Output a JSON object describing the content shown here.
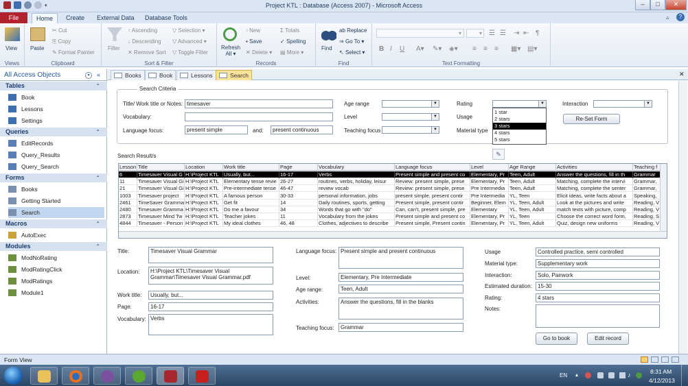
{
  "window": {
    "title": "Project KTL : Database (Access 2007)  -  Microsoft Access"
  },
  "ribbon_tabs": [
    "File",
    "Home",
    "Create",
    "External Data",
    "Database Tools"
  ],
  "ribbon": {
    "views": {
      "label": "Views",
      "view": "View"
    },
    "clipboard": {
      "label": "Clipboard",
      "paste": "Paste",
      "cut": "Cut",
      "copy": "Copy",
      "format_painter": "Format Painter"
    },
    "sortfilter": {
      "label": "Sort & Filter",
      "filter": "Filter",
      "ascending": "Ascending",
      "descending": "Descending",
      "remove_sort": "Remove Sort",
      "selection": "Selection",
      "advanced": "Advanced",
      "toggle_filter": "Toggle Filter"
    },
    "records": {
      "label": "Records",
      "refresh": "Refresh",
      "all": "All",
      "new": "New",
      "save": "Save",
      "delete": "Delete",
      "totals": "Totals",
      "spelling": "Spelling",
      "more": "More"
    },
    "find": {
      "label": "Find",
      "find": "Find",
      "replace": "Replace",
      "goto": "Go To",
      "select": "Select"
    },
    "textformatting": {
      "label": "Text Formatting"
    }
  },
  "nav": {
    "header": "All Access Objects",
    "sections": [
      {
        "title": "Tables",
        "items": [
          "Book",
          "Lessons",
          "Settings"
        ]
      },
      {
        "title": "Queries",
        "items": [
          "EditRecords",
          "Query_Results",
          "Query_Search"
        ]
      },
      {
        "title": "Forms",
        "items": [
          "Books",
          "Getting Started",
          "Search"
        ]
      },
      {
        "title": "Macros",
        "items": [
          "AutoExec"
        ]
      },
      {
        "title": "Modules",
        "items": [
          "ModNoRating",
          "ModRatingClick",
          "ModRatings",
          "Module1"
        ]
      }
    ]
  },
  "doc_tabs": [
    "Books",
    "Book",
    "Lessons",
    "Search"
  ],
  "criteria": {
    "title": "Search Criteria",
    "title_notes_label": "Title/ Work title or Notes:",
    "title_notes_value": "timesaver",
    "vocabulary_label": "Vocabulary:",
    "vocabulary_value": "",
    "language_focus_label": "Language focus:",
    "language_focus_value": "present simple",
    "and_label": "and:",
    "and_value": "present continuous",
    "age_range_label": "Age range",
    "level_label": "Level",
    "teaching_focus_label": "Teaching focus",
    "rating_label": "Rating",
    "usage_label": "Usage",
    "material_type_label": "Material type",
    "interaction_label": "Interaction",
    "reset_button": "Re-Set Form",
    "rating_options": [
      "1 star",
      "2 stars",
      "3 stars",
      "4 stars",
      "5 stars"
    ],
    "rating_selected": "3 stars"
  },
  "results": {
    "label": "Search Result/s",
    "columns": [
      "Lesson",
      "Title",
      "Location",
      "Work title",
      "Page",
      "Vocabulary",
      "Language focus",
      "Level",
      "Age Range",
      "Activities",
      "Teaching f"
    ],
    "rows": [
      [
        "6",
        "Timesaver Visual G",
        "H:\\Project KTL",
        "Usually, but...",
        "16-17",
        "Verbs",
        "Present simple and present co",
        "Elementary, Pr",
        "Teen, Adult",
        "Answer the questions, fill in th",
        "Grammar"
      ],
      [
        "11",
        "Timesaver Visual Gi",
        "H:\\Project KTL",
        "Elementary tense revie",
        "26-27",
        "routines, verbs, holiday, leisur",
        "Review: present simple, prese",
        "Elementary, Pr",
        "Teen, Adult",
        "Matching, complete the intervi",
        "Grammar,"
      ],
      [
        "21",
        "Timesaver Visual Gi",
        "H:\\Project KTL",
        "Pre-intermediate tense",
        "46-47",
        "review vocab",
        "Review: present simple, prese",
        "Pre Intermedia",
        "Teen, Adult",
        "Matching, complete the senter",
        "Grammar,"
      ],
      [
        "1003",
        "Timesaver project",
        "H:\\Project KTL",
        "A famous person",
        "30-33",
        "personal information, jobs",
        "present simple, present contir",
        "Pre Intermedia",
        "YL, Teen",
        "Elicit ideas, write facts about a",
        "Speaking,"
      ],
      [
        "2461",
        "TimeSaver Gramma",
        "H:\\Project KTL",
        "Get fit",
        "14",
        "Daily routines, sports, getting",
        "Present simple, present contir",
        "Beginner, Elem",
        "YL, Teen, Adult",
        "Look at the pictures and write",
        "Reading, V"
      ],
      [
        "2480",
        "Timesaver Gramma",
        "H:\\Project KTL",
        "Do me a favour",
        "34",
        "Words that go with \"do\"",
        "Can, can't, present simple, pre",
        "Elementary",
        "YL, Teen, Adult",
        "match texts with picture, comp",
        "Reading, V"
      ],
      [
        "2873",
        "Timesaver Mind Tw",
        "H:\\Project KTL",
        "Teacher jokes",
        "11",
        "Vocabulary from the jokes",
        "Present simple and present co",
        "Elementary, Pr",
        "YL, Teen",
        "Choose the correct word form,",
        "Reading, S"
      ],
      [
        "4844",
        "Timesaver - Person",
        "H:\\Project KTL",
        "My ideal clothes",
        "46, 48",
        "Clothes, adjectives to describe",
        "Present simple, Present contin",
        "Elementary, Pr",
        "YL, Teen, Adult",
        "Quiz, design new uniforms",
        "Reading, V"
      ]
    ]
  },
  "detail": {
    "title_label": "Title:",
    "title_value": "Timesaver Visual Grammar",
    "location_label": "Location:",
    "location_value": "H:\\Project KTL\\Timesaver Visual Grammar\\Timesaver Visual Grammar.pdf",
    "worktitle_label": "Work title:",
    "worktitle_value": "Usually, but...",
    "page_label": "Page:",
    "page_value": "16-17",
    "vocab_label": "Vocabulary:",
    "vocab_value": "Verbs",
    "langfocus_label": "Language focus:",
    "langfocus_value": "Present simple and present continuous",
    "level_label": "Level:",
    "level_value": "Elementary, Pre Intermediate",
    "agerange_label": "Age range:",
    "agerange_value": "Teen, Adult",
    "activities_label": "Activities:",
    "activities_value": "Answer the questions, fill in the blanks",
    "teachfocus_label": "Teaching focus:",
    "teachfocus_value": "Grammar",
    "usage_label": "Usage",
    "usage_value": "Controlled practice, semi controlled",
    "mattype_label": "Material type:",
    "mattype_value": "Supplementary work",
    "interaction_label": "Interaction:",
    "interaction_value": "Solo, Pairwork",
    "duration_label": "Estimated duration:",
    "duration_value": "15-30",
    "rating_label": "Rating:",
    "rating_value": "4 stars",
    "notes_label": "Notes:",
    "notes_value": "",
    "goto_button": "Go to book",
    "edit_button": "Edit record"
  },
  "status": {
    "text": "Form View"
  },
  "taskbar": {
    "lang": "EN",
    "time": "8:31 AM",
    "date": "4/12/2013"
  },
  "colors": {
    "file_tab": "#b1232d",
    "ribbon_bg": "#dbe6f4",
    "active_doc_tab": "#fbe39b",
    "nav_section": "#d6e1ef"
  }
}
